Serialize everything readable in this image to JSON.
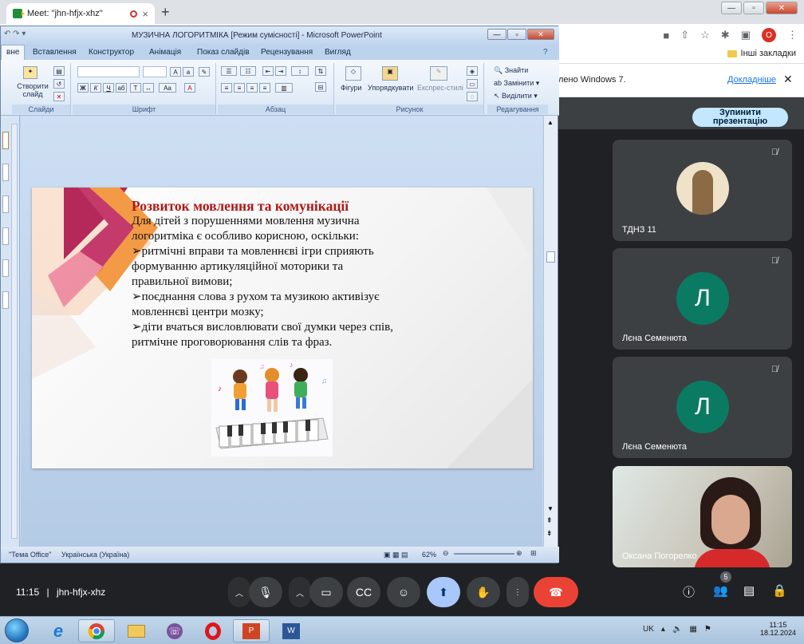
{
  "chrome": {
    "tab_title": "Meet: \"jhn-hfjx-xhz\"",
    "tab_close": "×",
    "new_tab": "+",
    "profile_letter": "O",
    "other_bookmarks": "Інші закладки",
    "infobar_text": "лено Windows 7.",
    "infobar_link": "Докладніше",
    "infobar_close": "✕"
  },
  "ppt": {
    "window_title": "МУЗИЧНА ЛОГОРИТМІКА [Режим сумісності] - Microsoft PowerPoint",
    "tabs": [
      "вне",
      "Вставлення",
      "Конструктор",
      "Анімація",
      "Показ слайдів",
      "Рецензування",
      "Вигляд"
    ],
    "ribbon": {
      "slides_group": "Слайди",
      "new_slide": "Створити слайд",
      "font_group": "Шрифт",
      "paragraph_group": "Абзац",
      "drawing_group": "Рисунок",
      "editing_group": "Редагування",
      "shapes": "Фігури",
      "arrange": "Упорядкувати",
      "quick_styles": "Експрес-стилі",
      "find": "Знайти",
      "replace": "Замінити",
      "select": "Виділити"
    },
    "status": {
      "theme": "\"Тема Office\"",
      "language": "Українська (Україна)",
      "zoom": "62%"
    }
  },
  "slide": {
    "title": "Розвиток мовлення та комунікації",
    "lines": [
      "Для дітей з порушеннями мовлення музична",
      "логоритміка є особливо корисною, оскільки:",
      "➢ритмічні вправи та мовленнєві ігри сприяють",
      "формуванню артикуляційної моторики та",
      "правильної вимови;",
      "➢поєднання слова з рухом та музикою активізує",
      "мовленнєві центри мозку;",
      "➢діти вчаться висловлювати свої думки через спів,",
      "ритмічне проговорювання слів та фраз."
    ]
  },
  "meet": {
    "stop_presenting": "Зупинити презентацію",
    "participants": [
      {
        "name": "ТДНЗ 11",
        "avatar": "photo"
      },
      {
        "name": "Лєна Семенюта",
        "avatar": "Л"
      },
      {
        "name": "Лєна Семенюта",
        "avatar": "Л"
      },
      {
        "name": "Оксана Погорелко",
        "avatar": "video"
      }
    ],
    "time": "11:15",
    "separator": "|",
    "meeting_code": "jhn-hfjx-xhz",
    "people_count": "5"
  },
  "taskbar": {
    "lang": "UK",
    "time": "11:15",
    "date": "18.12.2024"
  }
}
